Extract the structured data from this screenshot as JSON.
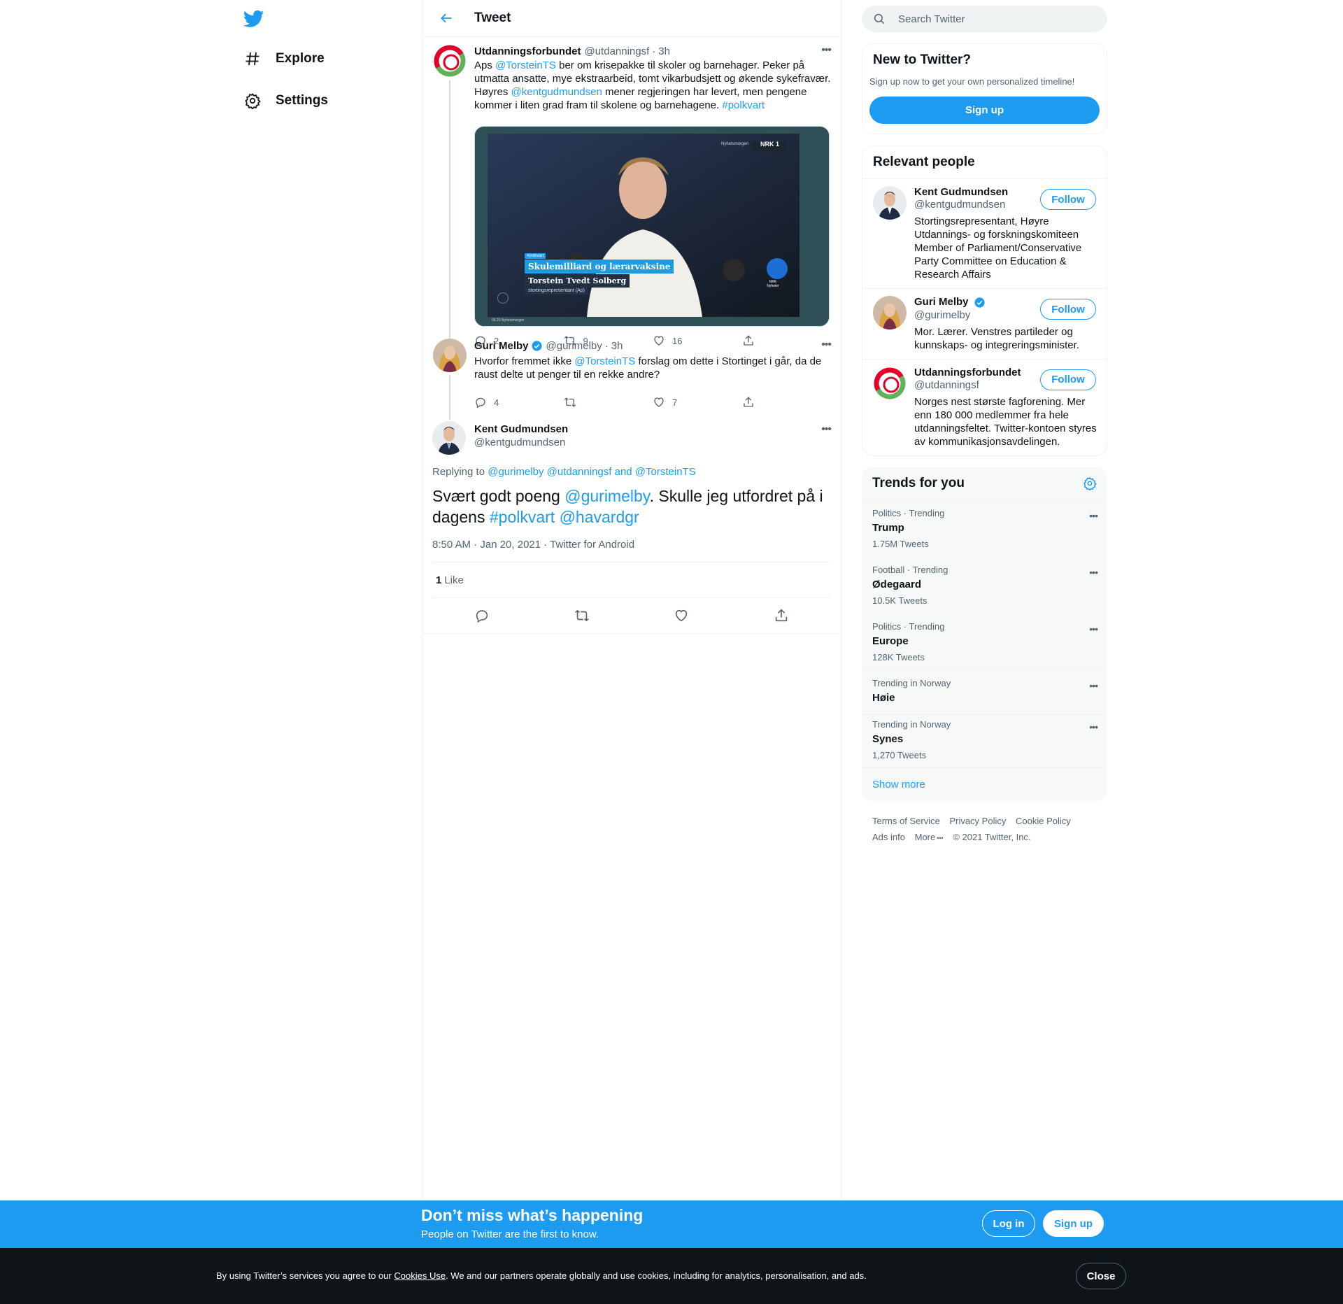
{
  "nav": {
    "explore": "Explore",
    "settings": "Settings"
  },
  "header": {
    "title": "Tweet"
  },
  "thread": [
    {
      "name": "Utdanningsforbundet",
      "handle": "@utdanningsf",
      "time": "3h",
      "text_parts": {
        "p1": "Aps ",
        "m1": "@TorsteinTS",
        "p2": " ber om krisepakke til skoler og barnehager. Peker på utmatta ansatte, mye ekstraarbeid, tomt vikarbudsjett og økende sykefravær. Høyres ",
        "m2": "@kentgudmundsen",
        "p3": " mener regjeringen har levert, men pengene kommer i liten grad fram til skolene og barnehagene. ",
        "h1": "#polkvart"
      },
      "media": {
        "tag": "#polkvart",
        "headline": "Skulemilliard og lærarvaksine",
        "person": "Torstein Tvedt Solberg",
        "role": "stortingsrepresentant (Ap)",
        "program": "Nyhetsmorgen",
        "channel": "NRK 1",
        "badge": "NRK Nyheter",
        "footer": "06.20 Nyhetsmorgen"
      },
      "replies": "2",
      "retweets": "9",
      "likes": "16"
    },
    {
      "name": "Guri Melby",
      "handle": "@gurimelby",
      "time": "3h",
      "text_parts": {
        "p1": "Hvorfor fremmet ikke ",
        "m1": "@TorsteinTS",
        "p2": " forslag om dette i Stortinget i går, da de raust delte ut penger til en rekke andre?"
      },
      "replies": "4",
      "retweets": "",
      "likes": "7"
    }
  ],
  "main_tweet": {
    "name": "Kent Gudmundsen",
    "handle": "@kentgudmundsen",
    "replying_prefix": "Replying to ",
    "replying_to": "@gurimelby @utdanningsf and @TorsteinTS",
    "text_parts": {
      "p1": "Svært godt poeng ",
      "m1": "@gurimelby",
      "p2": ". Skulle jeg utfordret på i dagens ",
      "h1": "#polkvart",
      "m2": "@havardgr"
    },
    "meta": "8:50 AM · Jan 20, 2021 · Twitter for Android",
    "like_count": "1",
    "like_label": "Like"
  },
  "sidebar": {
    "search_placeholder": "Search Twitter",
    "new_title": "New to Twitter?",
    "new_sub": "Sign up now to get your own personalized timeline!",
    "signup_label": "Sign up",
    "relevant_title": "Relevant people",
    "people": [
      {
        "name": "Kent Gudmundsen",
        "handle": "@kentgudmundsen",
        "bio": "Stortingsrepresentant, Høyre Utdannings- og forskningskomiteen Member of Parliament/Conservative Party Committee on Education & Research Affairs",
        "follow": "Follow"
      },
      {
        "name": "Guri Melby",
        "handle": "@gurimelby",
        "bio": "Mor. Lærer. Venstres partileder og kunnskaps- og integreringsminister.",
        "follow": "Follow"
      },
      {
        "name": "Utdanningsforbundet",
        "handle": "@utdanningsf",
        "bio": "Norges nest største fagforening. Mer enn 180 000 medlemmer fra hele utdanningsfeltet. Twitter-kontoen styres av kommunikasjonsavdelingen.",
        "follow": "Follow"
      }
    ],
    "trends_title": "Trends for you",
    "trends": [
      {
        "category": "Politics · Trending",
        "title": "Trump",
        "count": "1.75M Tweets"
      },
      {
        "category": "Football · Trending",
        "title": "Ødegaard",
        "count": "10.5K Tweets"
      },
      {
        "category": "Politics · Trending",
        "title": "Europe",
        "count": "128K Tweets"
      },
      {
        "category": "Trending in Norway",
        "title": "Høie",
        "count": ""
      },
      {
        "category": "Trending in Norway",
        "title": "Synes",
        "count": "1,270 Tweets"
      }
    ],
    "show_more": "Show more",
    "footer": {
      "terms": "Terms of Service",
      "privacy": "Privacy Policy",
      "cookie": "Cookie Policy",
      "ads": "Ads info",
      "more": "More",
      "copyright": "© 2021 Twitter, Inc."
    }
  },
  "signup_bar": {
    "title": "Don’t miss what’s happening",
    "subtitle": "People on Twitter are the first to know.",
    "login": "Log in",
    "signup": "Sign up"
  },
  "cookie_bar": {
    "text_before": "By using Twitter’s services you agree to our ",
    "link": "Cookies Use",
    "text_after": ". We and our partners operate globally and use cookies, including for analytics, personalisation, and ads.",
    "close": "Close"
  },
  "colors": {
    "accent": "#1d9bf0",
    "text": "#0f1419",
    "secondary": "#536471",
    "cookie_bg": "#0f1419"
  }
}
